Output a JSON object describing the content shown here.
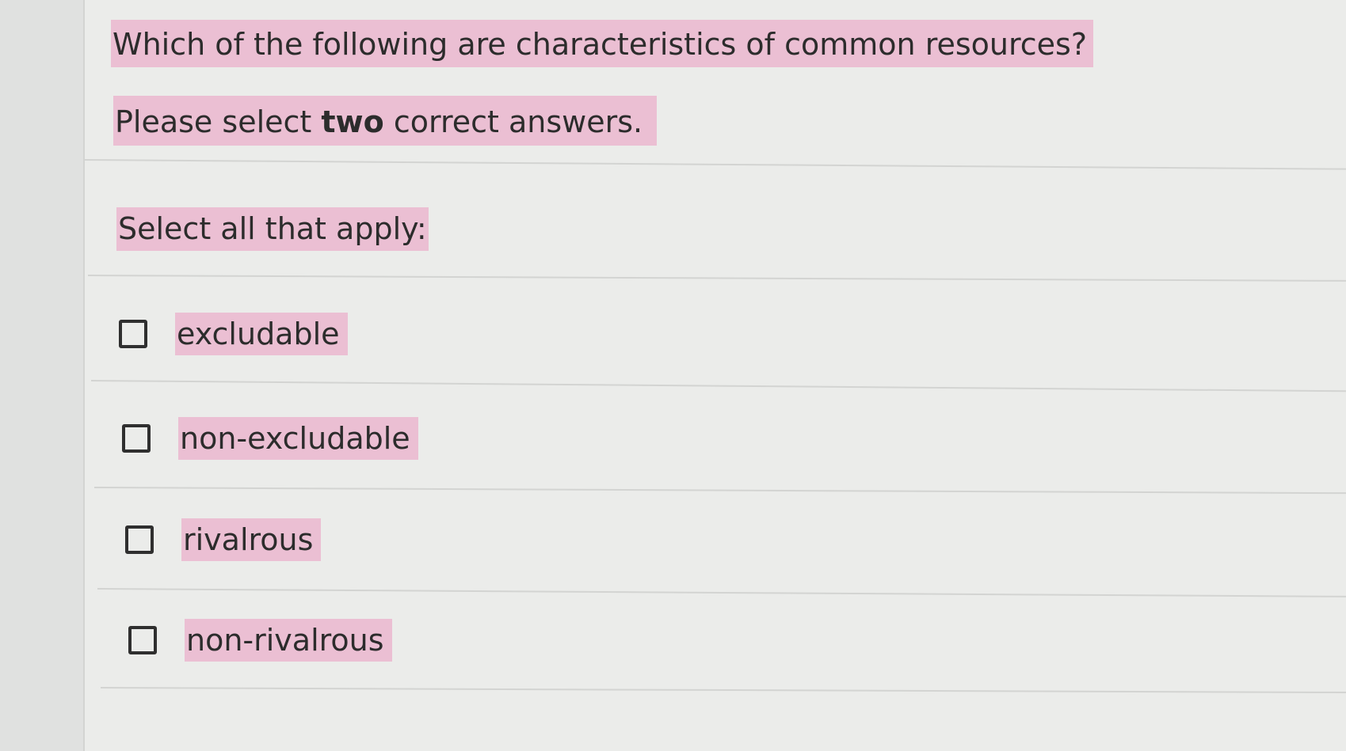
{
  "theme": {
    "highlight_color": "#ebbfd3",
    "text_color": "#2c2c2c",
    "background": "#ebecea"
  },
  "question": {
    "text": "Which of the following are characteristics of common resources?"
  },
  "instruction": {
    "prefix": "Please select ",
    "emphasis": "two",
    "suffix": " correct answers."
  },
  "select_label": "Select all that apply:",
  "options": [
    {
      "label": "excludable",
      "checked": false
    },
    {
      "label": "non-excludable",
      "checked": false
    },
    {
      "label": "rivalrous",
      "checked": false
    },
    {
      "label": "non-rivalrous",
      "checked": false
    }
  ]
}
